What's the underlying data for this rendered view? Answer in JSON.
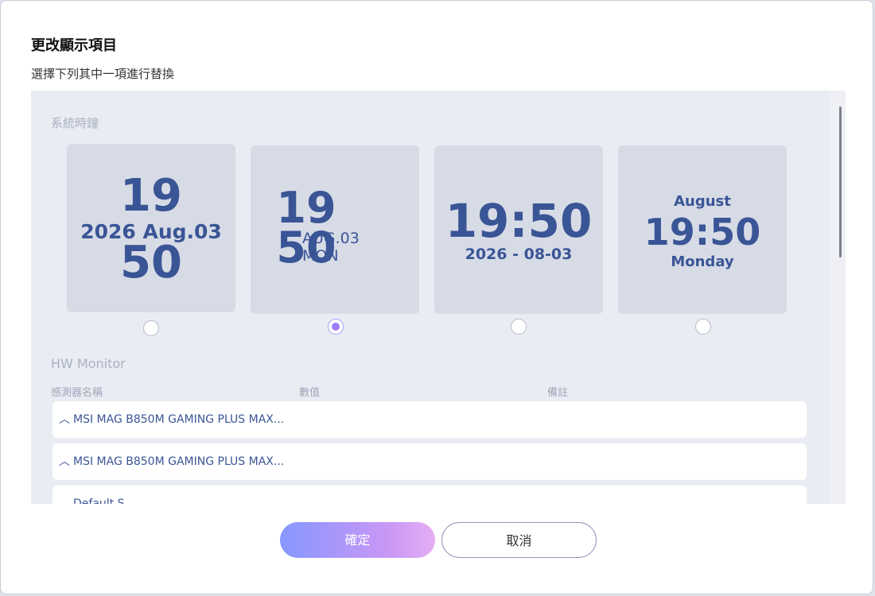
{
  "dialog": {
    "title": "更改顯示項目",
    "subtitle": "選擇下列其中一項進行替換"
  },
  "system_clock": {
    "label": "系統時鐘",
    "options": [
      {
        "lines": [
          "19",
          "2026 Aug.03",
          "50"
        ],
        "selected": false
      },
      {
        "hour": "19",
        "minute": "50",
        "date": "AUG.03",
        "weekday": "MON",
        "selected": true
      },
      {
        "time": "19:50",
        "date": "2026 - 08-03",
        "selected": false
      },
      {
        "month": "August",
        "time": "19:50",
        "weekday": "Monday",
        "selected": false
      }
    ]
  },
  "hw_monitor": {
    "label": "HW Monitor",
    "columns": [
      "感測器名稱",
      "數值",
      "備註"
    ],
    "rows": [
      {
        "name": "MSI MAG B850M GAMING PLUS MAX..."
      },
      {
        "name": "MSI MAG B850M GAMING PLUS MAX..."
      },
      {
        "name": "Default S..."
      }
    ]
  },
  "buttons": {
    "confirm": "確定",
    "cancel": "取消"
  },
  "colors": {
    "accent": "#3a5596",
    "card_bg": "#d7dbe6",
    "panel_bg": "#e9ecf3"
  }
}
